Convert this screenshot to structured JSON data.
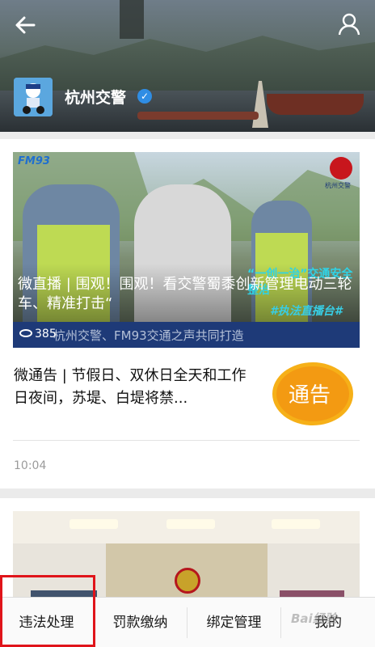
{
  "header": {
    "account_name": "杭州交警",
    "verified_mark": "✓"
  },
  "feed": {
    "article1": {
      "headline": "微直播 | 围观！围观！看交警蜀黍创新管理电动三轮车、精准打击“",
      "views": "385",
      "banner_text": "杭州交警、FM93交通之声共同打造",
      "tag_top": "“一创一治”交通安全整治",
      "tag_live": "#执法直播台#",
      "logo_left": "FM93",
      "logo_right": "杭州交警"
    },
    "article2": {
      "title": "微通告 | 节假日、双休日全天和工作日夜间，苏堤、白堤将禁...",
      "thumb_label": "通告",
      "time": "10:04"
    }
  },
  "tabbar": {
    "items": [
      {
        "label": "违法处理"
      },
      {
        "label": "罚款缴纳"
      },
      {
        "label": "绑定管理"
      },
      {
        "label": "我的"
      }
    ]
  },
  "watermark": "Bai经验",
  "colors": {
    "highlight": "#e0141a",
    "verified": "#2f8de4",
    "notice_orange": "#f39a12",
    "banner_blue": "#1e3a78"
  }
}
